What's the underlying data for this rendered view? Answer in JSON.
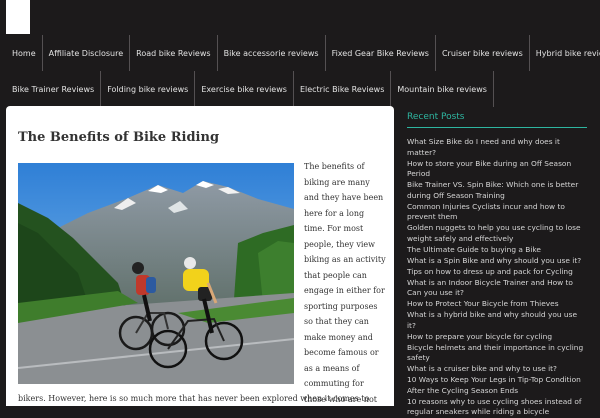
{
  "nav": {
    "row1": [
      "Home",
      "Affiliate Disclosure",
      "Road bike Reviews",
      "Bike accessorie reviews",
      "Fixed Gear Bike Reviews",
      "Cruiser bike reviews",
      "Hybrid bike reviews"
    ],
    "row2": [
      "Bike Trainer Reviews",
      "Folding bike reviews",
      "Exercise bike reviews",
      "Electric Bike Reviews",
      "Mountain bike reviews"
    ]
  },
  "post": {
    "title": "The Benefits of Bike Riding",
    "body_side": "The benefits of biking are many and they have been here for a long time. For most people, they view biking as an activity that people can engage in either for sporting purposes so that they can make money and become famous or as a means of commuting for those who are not professional",
    "body_bottom": "bikers. However, here is so much more that has never been explored when it comes to"
  },
  "sidebar": {
    "title": "Recent Posts",
    "posts": [
      "What Size Bike do I need and why does it matter?",
      "How to store your Bike during an Off Season Period",
      "Bike Trainer VS. Spin Bike: Which one is better during Off Season Training",
      "Common Injuries Cyclists incur and how to prevent them",
      "Golden nuggets to help you use cycling to lose weight safely and effectively",
      "The Ultimate Guide to buying a Bike",
      "What is a Spin Bike and why should you use it?",
      "Tips on how to dress up and pack for Cycling",
      "What is an Indoor Bicycle Trainer and How to Can you use it?",
      "How to Protect Your Bicycle from Thieves",
      "What is a hybrid bike and why should you use it?",
      "How to prepare your bicycle for cycling",
      "Bicycle helmets and their importance in cycling safety",
      "What is a cruiser bike and why to use it?",
      "10 Ways to Keep Your Legs in Tip-Top Condition After the Cycling Season Ends",
      "10 reasons why to use cycling shoes instead of regular sneakers while riding a bicycle"
    ]
  },
  "colors": {
    "background": "#1c1a1b",
    "accent": "#2eb5a0",
    "content_bg": "#ffffff",
    "nav_text": "#e3e3e3"
  }
}
